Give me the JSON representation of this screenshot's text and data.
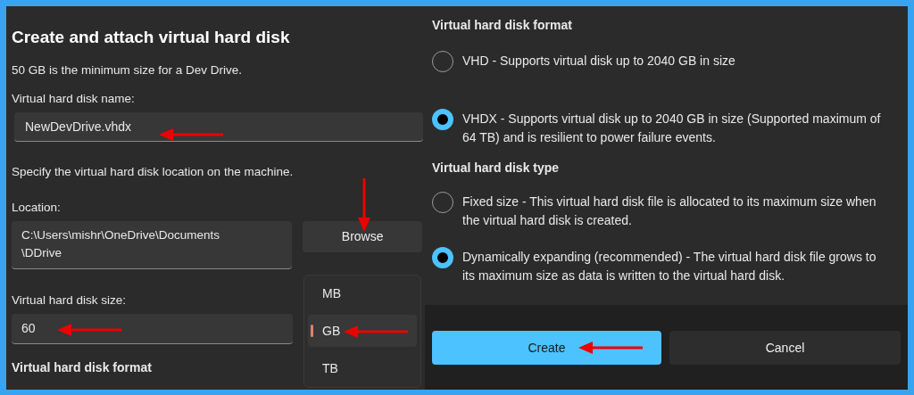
{
  "left": {
    "title": "Create and attach virtual hard disk",
    "note": "50 GB is the minimum size for a Dev Drive.",
    "name_label": "Virtual hard disk name:",
    "name_value": "NewDevDrive.vhdx",
    "location_hint": "Specify the virtual hard disk location on the machine.",
    "location_label": "Location:",
    "location_value": "C:\\Users\\mishr\\OneDrive\\Documents\n\\DDrive",
    "browse_button": "Browse",
    "size_label": "Virtual hard disk size:",
    "size_value": "60",
    "unit_menu": [
      {
        "label": "MB",
        "selected": false
      },
      {
        "label": "GB",
        "selected": true
      },
      {
        "label": "TB",
        "selected": false
      }
    ],
    "format_heading": "Virtual hard disk format"
  },
  "right": {
    "format_heading": "Virtual hard disk format",
    "format_options": [
      {
        "label": "VHD - Supports virtual disk up to 2040 GB in size",
        "selected": false
      },
      {
        "label": "VHDX - Supports virtual disk up to 2040 GB in size (Supported maximum of 64 TB) and is resilient to power failure events.",
        "selected": true
      }
    ],
    "type_heading": "Virtual hard disk type",
    "type_options": [
      {
        "label": "Fixed size - This virtual hard disk file is allocated to its maximum size when the virtual hard disk is created.",
        "selected": false
      },
      {
        "label": "Dynamically expanding (recommended) - The virtual hard disk file grows to its maximum size as data is written to the virtual hard disk.",
        "selected": true
      }
    ],
    "buttons": [
      "Create",
      "Cancel"
    ]
  }
}
